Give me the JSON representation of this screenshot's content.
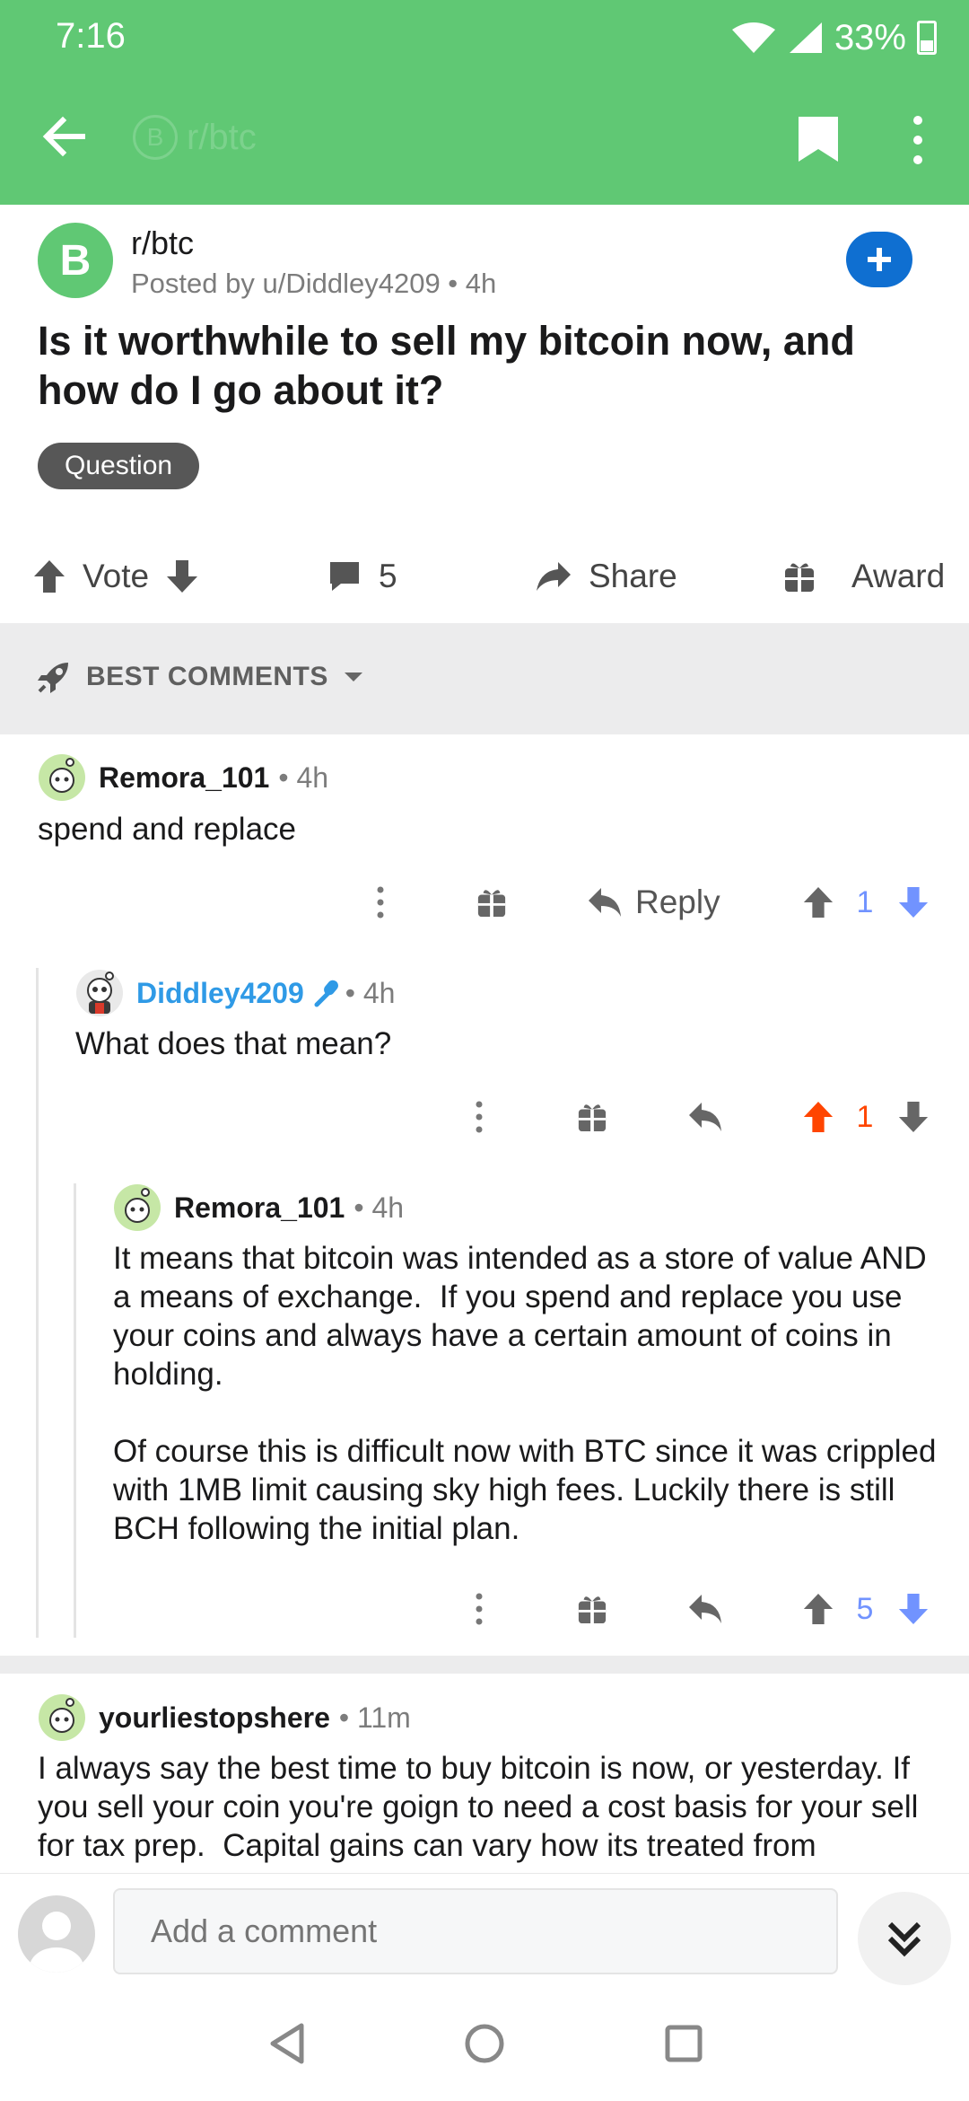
{
  "status_bar": {
    "time": "7:16",
    "battery": "33%"
  },
  "app_bar": {
    "ghost_title": "r/btc",
    "ghost_logo": "B",
    "back_icon": "arrow-left-icon",
    "bookmark_icon": "bookmark-icon",
    "more_icon": "more-vertical-icon"
  },
  "post": {
    "subreddit": "r/btc",
    "subreddit_icon_letter": "B",
    "posted_by": "Posted by u/Diddley4209 • 4h",
    "title": "Is it worthwhile to sell my bitcoin now, and how do I go about it?",
    "flair": "Question",
    "actions": {
      "vote_label": "Vote",
      "comment_count": "5",
      "share_label": "Share",
      "award_label": "Award"
    }
  },
  "sort": {
    "label": "BEST COMMENTS"
  },
  "comments": [
    {
      "author": "Remora_101",
      "meta": "• 4h",
      "body": "spend and replace",
      "reply_label": "Reply",
      "score": "1"
    },
    {
      "author": "Diddley4209",
      "meta": "• 4h",
      "body": "What does that mean?",
      "score": "1"
    },
    {
      "author": "Remora_101",
      "meta": "• 4h",
      "body": "It means that bitcoin was intended as a store of value AND a means of exchange.  If you spend and replace you use your coins and always have a certain amount of coins in holding.\n\nOf course this is difficult now with BTC since it was crippled with 1MB limit causing sky high fees. Luckily there is still BCH following the initial plan.",
      "score": "5"
    },
    {
      "author": "yourliestopshere",
      "meta": "• 11m",
      "body": "I always say the best time to buy bitcoin is now, or yesterday. If you sell your coin you're goign to need a cost basis for your sell for tax prep.  Capital gains can vary how its treated from"
    }
  ],
  "composer": {
    "placeholder": "Add a comment"
  },
  "colors": {
    "header_green": "#60c874",
    "join_blue": "#0f6fd1",
    "upvote_orange": "#ff4500",
    "downvote_blue": "#7193ff",
    "op_blue": "#2f9ae6"
  }
}
